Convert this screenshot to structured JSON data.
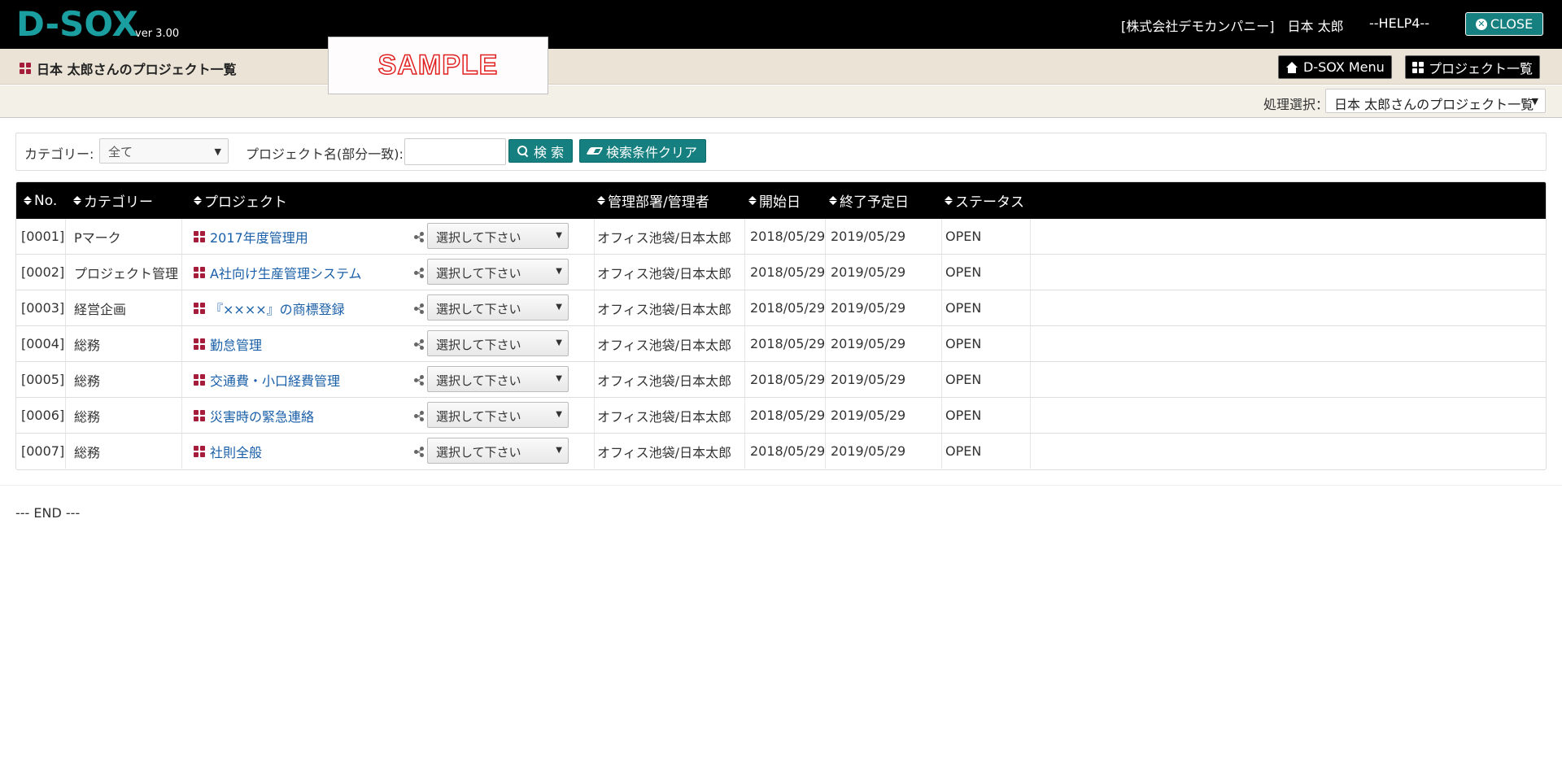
{
  "header": {
    "logo": "D-SOX",
    "version": "ver 3.00",
    "company_user": "[株式会社デモカンパニー]　日本 太郎",
    "help": "--HELP4--",
    "close_label": "CLOSE"
  },
  "subheader": {
    "page_title": "日本 太郎さんのプロジェクト一覧",
    "sample_stamp": "SAMPLE",
    "menu_button": "D-SOX Menu",
    "project_list_button": "プロジェクト一覧"
  },
  "process": {
    "label": "処理選択：",
    "selected": "日本 太郎さんのプロジェクト一覧"
  },
  "search": {
    "category_label": "カテゴリー:",
    "category_value": "全て",
    "name_label": "プロジェクト名(部分一致):",
    "name_value": "",
    "search_button": "検 索",
    "clear_button": "検索条件クリア"
  },
  "table": {
    "headers": {
      "no": "No.",
      "category": "カテゴリー",
      "project": "プロジェクト",
      "dept": "管理部署/管理者",
      "start": "開始日",
      "end": "終了予定日",
      "status": "ステータス"
    },
    "rows": [
      {
        "no": "[0001]",
        "category": "Pマーク",
        "project": "2017年度管理用",
        "select": "選択して下さい",
        "dept": "オフィス池袋/日本太郎",
        "start": "2018/05/29",
        "end": "2019/05/29",
        "status": "OPEN"
      },
      {
        "no": "[0002]",
        "category": "プロジェクト管理",
        "project": "A社向け生産管理システム",
        "select": "選択して下さい",
        "dept": "オフィス池袋/日本太郎",
        "start": "2018/05/29",
        "end": "2019/05/29",
        "status": "OPEN"
      },
      {
        "no": "[0003]",
        "category": "経営企画",
        "project": "『××××』の商標登録",
        "select": "選択して下さい",
        "dept": "オフィス池袋/日本太郎",
        "start": "2018/05/29",
        "end": "2019/05/29",
        "status": "OPEN"
      },
      {
        "no": "[0004]",
        "category": "総務",
        "project": "勤怠管理",
        "select": "選択して下さい",
        "dept": "オフィス池袋/日本太郎",
        "start": "2018/05/29",
        "end": "2019/05/29",
        "status": "OPEN"
      },
      {
        "no": "[0005]",
        "category": "総務",
        "project": "交通費・小口経費管理",
        "select": "選択して下さい",
        "dept": "オフィス池袋/日本太郎",
        "start": "2018/05/29",
        "end": "2019/05/29",
        "status": "OPEN"
      },
      {
        "no": "[0006]",
        "category": "総務",
        "project": "災害時の緊急連絡",
        "select": "選択して下さい",
        "dept": "オフィス池袋/日本太郎",
        "start": "2018/05/29",
        "end": "2019/05/29",
        "status": "OPEN"
      },
      {
        "no": "[0007]",
        "category": "総務",
        "project": "社則全般",
        "select": "選択して下さい",
        "dept": "オフィス池袋/日本太郎",
        "start": "2018/05/29",
        "end": "2019/05/29",
        "status": "OPEN"
      }
    ]
  },
  "footer": {
    "end_text": "--- END ---"
  },
  "colors": {
    "brand_teal": "#167f80",
    "logo_teal": "#1a9ea0",
    "icon_red": "#a51d3a",
    "link_blue": "#1a5fa8"
  }
}
